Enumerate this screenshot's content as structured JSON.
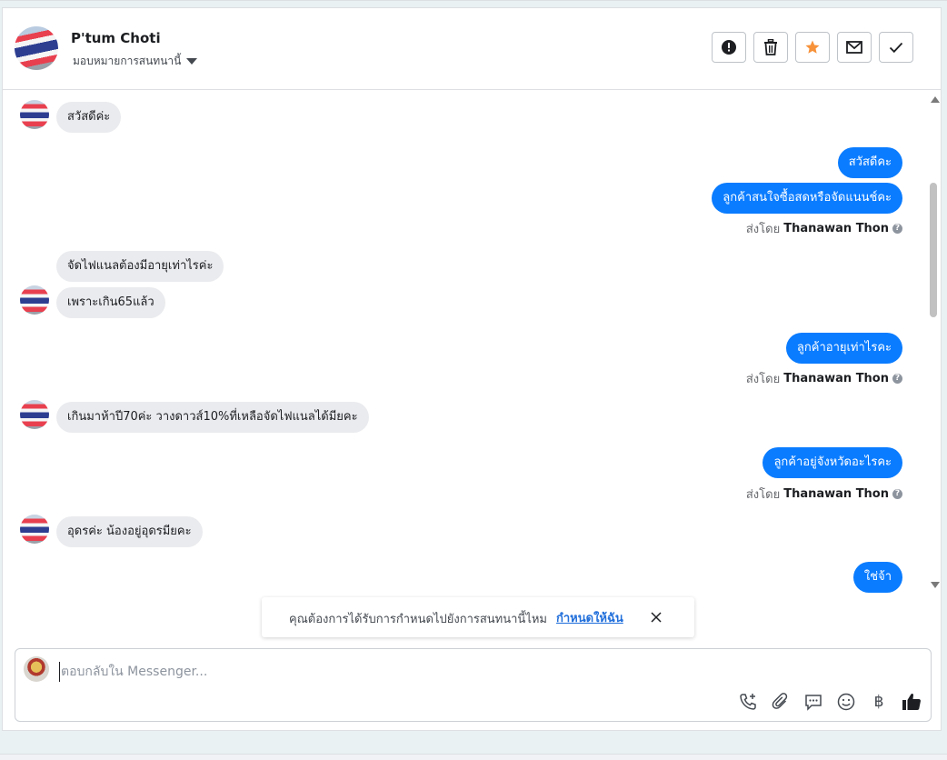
{
  "header": {
    "contact_name": "P'tum Choti",
    "assign_label": "มอบหมายการสนทนานี้",
    "actions": [
      "alert-icon",
      "trash-icon",
      "star-icon",
      "mail-icon",
      "check-icon"
    ],
    "colors": {
      "star": "#f7923a"
    }
  },
  "messages": {
    "in_1": "สวัสดีค่ะ",
    "out_1": "สวัสดีคะ",
    "out_2": "ลูกค้าสนใจซื้อสดหรือจัดแนนช์คะ",
    "sentby_prefix": "ส่งโดย",
    "sender": "Thanawan Thon",
    "in_2": "จัดไฟแนลต้องมีอายุเท่าไรค่ะ",
    "in_3": "เพราะเกิน65แล้ว",
    "out_3": "ลูกค้าอายุเท่าไรคะ",
    "in_4": "เกินมาห้าปี70ค่ะ วางดาวส์10%ที่เหลือจัดไฟแนลได้มีย​คะ",
    "out_4": "ลูกค้าอยู่จังหวัดอะไรคะ",
    "in_5": "อุดรค่ะ น้องอยู่อุดรมีย​คะ",
    "out_5": "ใช่จ้า"
  },
  "notice": {
    "text": "คุณต้องการได้รับการกำหนดไปยังการสนทนานี้ไหม",
    "link": "กำหนดให้ฉัน"
  },
  "composer": {
    "placeholder": "ตอบกลับใน Messenger...",
    "tools": [
      "call-add-icon",
      "attach-icon",
      "saved-reply-icon",
      "emoji-icon",
      "baht-icon",
      "thumbs-up-icon"
    ],
    "baht_symbol": "฿"
  },
  "colors": {
    "outgoing_bubble": "#0a7cff",
    "incoming_bubble": "#eaebee",
    "link": "#216fdb"
  }
}
